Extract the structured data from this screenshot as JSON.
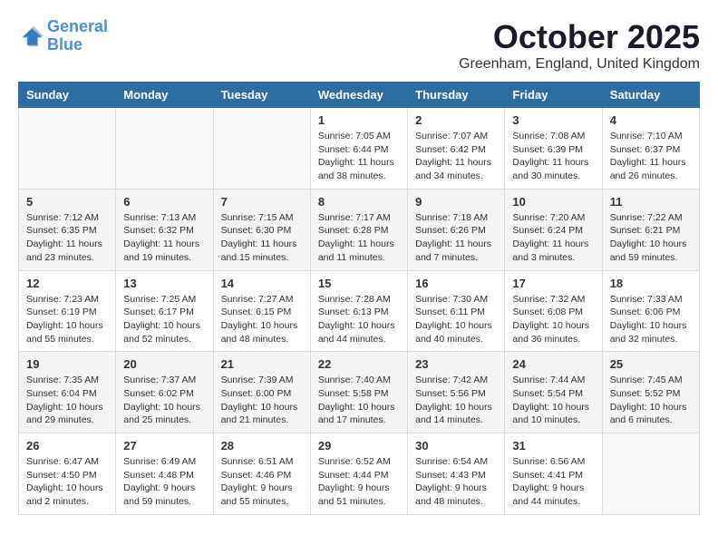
{
  "logo": {
    "line1": "General",
    "line2": "Blue"
  },
  "title": "October 2025",
  "location": "Greenham, England, United Kingdom",
  "weekdays": [
    "Sunday",
    "Monday",
    "Tuesday",
    "Wednesday",
    "Thursday",
    "Friday",
    "Saturday"
  ],
  "weeks": [
    [
      {
        "day": "",
        "info": ""
      },
      {
        "day": "",
        "info": ""
      },
      {
        "day": "",
        "info": ""
      },
      {
        "day": "1",
        "info": "Sunrise: 7:05 AM\nSunset: 6:44 PM\nDaylight: 11 hours and 38 minutes."
      },
      {
        "day": "2",
        "info": "Sunrise: 7:07 AM\nSunset: 6:42 PM\nDaylight: 11 hours and 34 minutes."
      },
      {
        "day": "3",
        "info": "Sunrise: 7:08 AM\nSunset: 6:39 PM\nDaylight: 11 hours and 30 minutes."
      },
      {
        "day": "4",
        "info": "Sunrise: 7:10 AM\nSunset: 6:37 PM\nDaylight: 11 hours and 26 minutes."
      }
    ],
    [
      {
        "day": "5",
        "info": "Sunrise: 7:12 AM\nSunset: 6:35 PM\nDaylight: 11 hours and 23 minutes."
      },
      {
        "day": "6",
        "info": "Sunrise: 7:13 AM\nSunset: 6:32 PM\nDaylight: 11 hours and 19 minutes."
      },
      {
        "day": "7",
        "info": "Sunrise: 7:15 AM\nSunset: 6:30 PM\nDaylight: 11 hours and 15 minutes."
      },
      {
        "day": "8",
        "info": "Sunrise: 7:17 AM\nSunset: 6:28 PM\nDaylight: 11 hours and 11 minutes."
      },
      {
        "day": "9",
        "info": "Sunrise: 7:18 AM\nSunset: 6:26 PM\nDaylight: 11 hours and 7 minutes."
      },
      {
        "day": "10",
        "info": "Sunrise: 7:20 AM\nSunset: 6:24 PM\nDaylight: 11 hours and 3 minutes."
      },
      {
        "day": "11",
        "info": "Sunrise: 7:22 AM\nSunset: 6:21 PM\nDaylight: 10 hours and 59 minutes."
      }
    ],
    [
      {
        "day": "12",
        "info": "Sunrise: 7:23 AM\nSunset: 6:19 PM\nDaylight: 10 hours and 55 minutes."
      },
      {
        "day": "13",
        "info": "Sunrise: 7:25 AM\nSunset: 6:17 PM\nDaylight: 10 hours and 52 minutes."
      },
      {
        "day": "14",
        "info": "Sunrise: 7:27 AM\nSunset: 6:15 PM\nDaylight: 10 hours and 48 minutes."
      },
      {
        "day": "15",
        "info": "Sunrise: 7:28 AM\nSunset: 6:13 PM\nDaylight: 10 hours and 44 minutes."
      },
      {
        "day": "16",
        "info": "Sunrise: 7:30 AM\nSunset: 6:11 PM\nDaylight: 10 hours and 40 minutes."
      },
      {
        "day": "17",
        "info": "Sunrise: 7:32 AM\nSunset: 6:08 PM\nDaylight: 10 hours and 36 minutes."
      },
      {
        "day": "18",
        "info": "Sunrise: 7:33 AM\nSunset: 6:06 PM\nDaylight: 10 hours and 32 minutes."
      }
    ],
    [
      {
        "day": "19",
        "info": "Sunrise: 7:35 AM\nSunset: 6:04 PM\nDaylight: 10 hours and 29 minutes."
      },
      {
        "day": "20",
        "info": "Sunrise: 7:37 AM\nSunset: 6:02 PM\nDaylight: 10 hours and 25 minutes."
      },
      {
        "day": "21",
        "info": "Sunrise: 7:39 AM\nSunset: 6:00 PM\nDaylight: 10 hours and 21 minutes."
      },
      {
        "day": "22",
        "info": "Sunrise: 7:40 AM\nSunset: 5:58 PM\nDaylight: 10 hours and 17 minutes."
      },
      {
        "day": "23",
        "info": "Sunrise: 7:42 AM\nSunset: 5:56 PM\nDaylight: 10 hours and 14 minutes."
      },
      {
        "day": "24",
        "info": "Sunrise: 7:44 AM\nSunset: 5:54 PM\nDaylight: 10 hours and 10 minutes."
      },
      {
        "day": "25",
        "info": "Sunrise: 7:45 AM\nSunset: 5:52 PM\nDaylight: 10 hours and 6 minutes."
      }
    ],
    [
      {
        "day": "26",
        "info": "Sunrise: 6:47 AM\nSunset: 4:50 PM\nDaylight: 10 hours and 2 minutes."
      },
      {
        "day": "27",
        "info": "Sunrise: 6:49 AM\nSunset: 4:48 PM\nDaylight: 9 hours and 59 minutes."
      },
      {
        "day": "28",
        "info": "Sunrise: 6:51 AM\nSunset: 4:46 PM\nDaylight: 9 hours and 55 minutes."
      },
      {
        "day": "29",
        "info": "Sunrise: 6:52 AM\nSunset: 4:44 PM\nDaylight: 9 hours and 51 minutes."
      },
      {
        "day": "30",
        "info": "Sunrise: 6:54 AM\nSunset: 4:43 PM\nDaylight: 9 hours and 48 minutes."
      },
      {
        "day": "31",
        "info": "Sunrise: 6:56 AM\nSunset: 4:41 PM\nDaylight: 9 hours and 44 minutes."
      },
      {
        "day": "",
        "info": ""
      }
    ]
  ]
}
